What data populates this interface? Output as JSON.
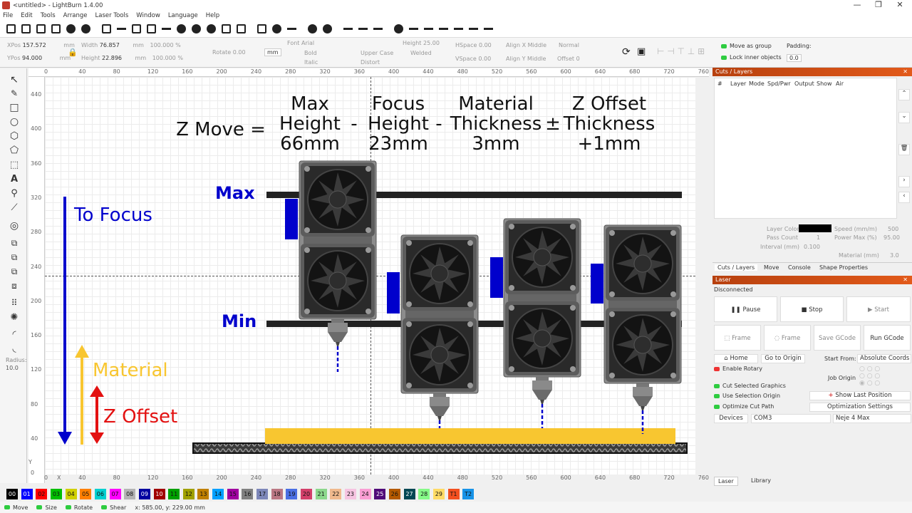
{
  "window": {
    "title": "<untitled> - LightBurn 1.4.00",
    "min": "—",
    "max": "❐",
    "close": "✕"
  },
  "menu": [
    "File",
    "Edit",
    "Tools",
    "Arrange",
    "Laser Tools",
    "Window",
    "Language",
    "Help"
  ],
  "props": {
    "xpos_label": "XPos",
    "xpos": "157.572",
    "ypos_label": "YPos",
    "ypos": "94.000",
    "mm": "mm",
    "width_label": "Width",
    "width": "76.857",
    "height_label": "Height",
    "height": "22.896",
    "scale_w": "100.000",
    "scale_h": "100.000",
    "pct": "%",
    "rotate_label": "Rotate",
    "rotate": "0.00",
    "unit_button": "mm",
    "font_label": "Font",
    "font": "Arial",
    "bold": "Bold",
    "italic": "Italic",
    "upper_case": "Upper Case",
    "welded": "Welded",
    "distort": "Distort",
    "text_height_label": "Height",
    "text_height": "25.00",
    "hspace_label": "HSpace",
    "hspace": "0.00",
    "vspace_label": "VSpace",
    "vspace": "0.00",
    "alignx_label": "Align X",
    "alignx": "Middle",
    "aligny_label": "Align Y",
    "aligny": "Middle",
    "mode": "Normal",
    "offset_label": "Offset",
    "offset": "0",
    "move_as_group": "Move as group",
    "lock_inner": "Lock inner objects",
    "padding_label": "Padding:",
    "padding": "0.0"
  },
  "ruler": {
    "top": [
      "0",
      "40",
      "80",
      "120",
      "160",
      "200",
      "240",
      "280",
      "320",
      "360",
      "400",
      "440",
      "480",
      "520",
      "560",
      "600",
      "640",
      "680",
      "720",
      "760"
    ],
    "left": [
      "440",
      "400",
      "360",
      "320",
      "280",
      "240",
      "200",
      "160",
      "120",
      "80",
      "40",
      "0"
    ],
    "bottom": [
      "0",
      "40",
      "80",
      "120",
      "160",
      "200",
      "240",
      "280",
      "320",
      "360",
      "400",
      "440",
      "480",
      "520",
      "560",
      "600",
      "640",
      "680",
      "720",
      "760"
    ],
    "x_axis": "X",
    "y_axis": "Y"
  },
  "design": {
    "eq_prefix": "Z Move =",
    "terms": [
      {
        "line1": "Max",
        "line2": "Height",
        "line3": "66mm"
      },
      {
        "line1": "Focus",
        "line2": "Height",
        "line3": "23mm"
      },
      {
        "line1": "Material",
        "line2": "Thickness",
        "line3": "3mm"
      },
      {
        "line1": "Z Offset",
        "line2": "Thickness",
        "line3": "+1mm"
      }
    ],
    "ops": [
      "-",
      "-",
      "±"
    ],
    "max_label": "Max",
    "min_label": "Min",
    "to_focus": "To Focus",
    "material": "Material",
    "z_offset": "Z Offset",
    "colors": {
      "blue": "#0000cc",
      "yellow": "#f8c630",
      "red": "#e31010",
      "bar": "#222222"
    }
  },
  "radius": {
    "label": "Radius:",
    "value": "10.0"
  },
  "cuts": {
    "title": "Cuts / Layers",
    "columns": [
      "#",
      "Layer",
      "Mode",
      "Spd/Pwr",
      "Output",
      "Show",
      "Air"
    ],
    "layer_color": "Layer Color",
    "speed_label": "Speed (mm/m)",
    "speed": "500",
    "pass_count_label": "Pass Count",
    "pass_count": "1",
    "power_max_label": "Power Max (%)",
    "power_max": "95.00",
    "interval_label": "Interval (mm)",
    "interval": "0.100",
    "material_label": "Material (mm)",
    "material": "3.0"
  },
  "tabs": [
    "Cuts / Layers",
    "Move",
    "Console",
    "Shape Properties"
  ],
  "laser": {
    "title": "Laser",
    "status": "Disconnected",
    "pause": "Pause",
    "stop": "Stop",
    "start": "Start",
    "frame1": "Frame",
    "frame2": "Frame",
    "save_gcode": "Save GCode",
    "run_gcode": "Run GCode",
    "home": "Home",
    "go_to_origin": "Go to Origin",
    "start_from_label": "Start From:",
    "start_from": "Absolute Coords",
    "enable_rotary": "Enable Rotary",
    "job_origin": "Job Origin",
    "cut_selected": "Cut Selected Graphics",
    "use_selection_origin": "Use Selection Origin",
    "optimize_cut": "Optimize Cut Path",
    "show_last": "Show Last Position",
    "opt_settings": "Optimization Settings",
    "devices": "Devices",
    "port": "COM3",
    "device": "Neje 4 Max"
  },
  "bottom_tabs": [
    "Laser",
    "Library"
  ],
  "palette": [
    {
      "l": "00",
      "c": "#000000"
    },
    {
      "l": "01",
      "c": "#0000ff"
    },
    {
      "l": "02",
      "c": "#ff0000"
    },
    {
      "l": "03",
      "c": "#00c000"
    },
    {
      "l": "04",
      "c": "#d0d000"
    },
    {
      "l": "05",
      "c": "#ff8000"
    },
    {
      "l": "06",
      "c": "#00d0d0"
    },
    {
      "l": "07",
      "c": "#ff00ff"
    },
    {
      "l": "08",
      "c": "#b4b4b4"
    },
    {
      "l": "09",
      "c": "#0000a0"
    },
    {
      "l": "10",
      "c": "#a00000"
    },
    {
      "l": "11",
      "c": "#00a000"
    },
    {
      "l": "12",
      "c": "#a0a000"
    },
    {
      "l": "13",
      "c": "#c08000"
    },
    {
      "l": "14",
      "c": "#00a0ff"
    },
    {
      "l": "15",
      "c": "#a000a0"
    },
    {
      "l": "16",
      "c": "#808080"
    },
    {
      "l": "17",
      "c": "#7d87b9"
    },
    {
      "l": "18",
      "c": "#bb7784"
    },
    {
      "l": "19",
      "c": "#4a6fe3"
    },
    {
      "l": "20",
      "c": "#d33f6a"
    },
    {
      "l": "21",
      "c": "#8cd78c"
    },
    {
      "l": "22",
      "c": "#f0b98d"
    },
    {
      "l": "23",
      "c": "#f6c4e1"
    },
    {
      "l": "24",
      "c": "#fa9ed4"
    },
    {
      "l": "25",
      "c": "#500a78"
    },
    {
      "l": "26",
      "c": "#b45a00"
    },
    {
      "l": "27",
      "c": "#004754"
    },
    {
      "l": "28",
      "c": "#86fa88"
    },
    {
      "l": "29",
      "c": "#ffdb66"
    },
    {
      "l": "T1",
      "c": "#f35020"
    },
    {
      "l": "T2",
      "c": "#1793e8"
    }
  ],
  "status": {
    "move": "Move",
    "size": "Size",
    "rotate": "Rotate",
    "shear": "Shear",
    "coords": "x: 585.00, y: 229.00 mm"
  }
}
